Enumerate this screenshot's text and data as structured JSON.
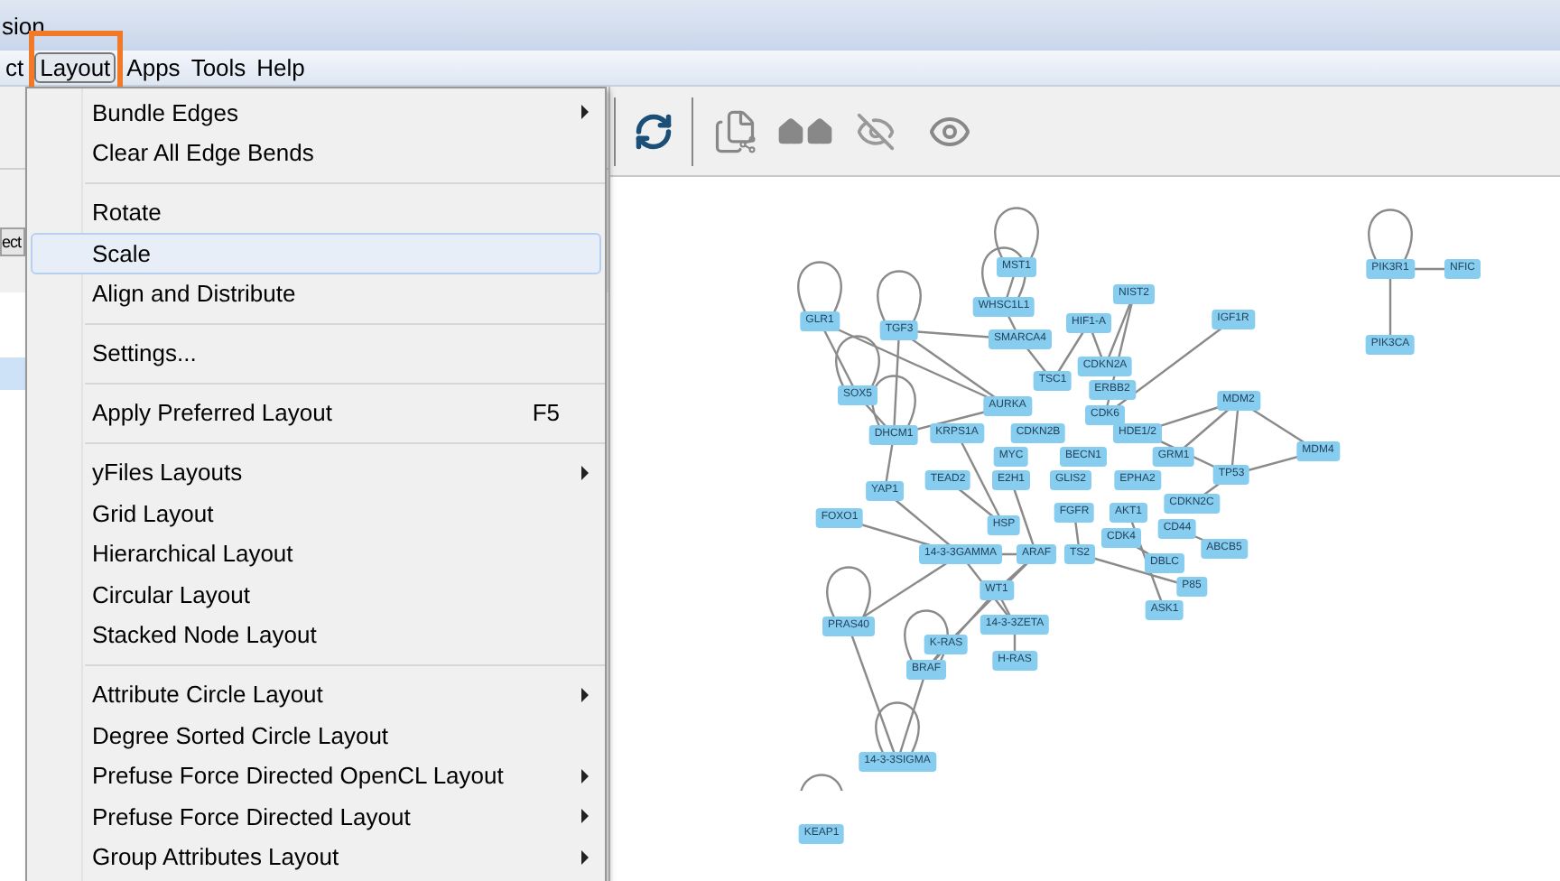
{
  "window": {
    "title": "sion"
  },
  "menu_bar": [
    {
      "label": "ct",
      "selected": false,
      "annotated": false
    },
    {
      "label": "Layout",
      "selected": true,
      "annotated": true
    },
    {
      "label": "Apps",
      "selected": false,
      "annotated": false
    },
    {
      "label": "Tools",
      "selected": false,
      "annotated": false
    },
    {
      "label": "Help",
      "selected": false,
      "annotated": false
    }
  ],
  "left_panel": {
    "button_label": "ect",
    "rows": [
      {
        "selected": true
      }
    ]
  },
  "layout_menu": [
    {
      "kind": "item",
      "label": "Bundle Edges",
      "submenu": true,
      "highlighted": false
    },
    {
      "kind": "item",
      "label": "Clear All Edge Bends",
      "submenu": false,
      "highlighted": false
    },
    {
      "kind": "separator"
    },
    {
      "kind": "item",
      "label": "Rotate",
      "submenu": false,
      "highlighted": false
    },
    {
      "kind": "item",
      "label": "Scale",
      "submenu": false,
      "highlighted": true
    },
    {
      "kind": "item",
      "label": "Align and Distribute",
      "submenu": false,
      "highlighted": false
    },
    {
      "kind": "separator"
    },
    {
      "kind": "item",
      "label": "Settings...",
      "submenu": false,
      "highlighted": false
    },
    {
      "kind": "separator"
    },
    {
      "kind": "item",
      "label": "Apply Preferred Layout",
      "shortcut": "F5",
      "submenu": false,
      "highlighted": false
    },
    {
      "kind": "separator"
    },
    {
      "kind": "item",
      "label": "yFiles Layouts",
      "submenu": true,
      "highlighted": false
    },
    {
      "kind": "item",
      "label": "Grid Layout",
      "submenu": false,
      "highlighted": false
    },
    {
      "kind": "item",
      "label": "Hierarchical Layout",
      "submenu": false,
      "highlighted": false
    },
    {
      "kind": "item",
      "label": "Circular Layout",
      "submenu": false,
      "highlighted": false
    },
    {
      "kind": "item",
      "label": "Stacked Node Layout",
      "submenu": false,
      "highlighted": false
    },
    {
      "kind": "separator"
    },
    {
      "kind": "item",
      "label": "Attribute Circle Layout",
      "submenu": true,
      "highlighted": false
    },
    {
      "kind": "item",
      "label": "Degree Sorted Circle Layout",
      "submenu": false,
      "highlighted": false
    },
    {
      "kind": "item",
      "label": "Prefuse Force Directed OpenCL Layout",
      "submenu": true,
      "highlighted": false
    },
    {
      "kind": "item",
      "label": "Prefuse Force Directed Layout",
      "submenu": true,
      "highlighted": false
    },
    {
      "kind": "item",
      "label": "Group Attributes Layout",
      "submenu": true,
      "highlighted": false
    }
  ],
  "network": {
    "nodes": [
      {
        "label": "MST1"
      },
      {
        "label": "WHSC1L1"
      },
      {
        "label": "NIST2"
      },
      {
        "label": "HIF1-A"
      },
      {
        "label": "SMARCA4"
      },
      {
        "label": "GLR1"
      },
      {
        "label": "TGF3"
      },
      {
        "label": "IGF1R"
      },
      {
        "label": "PIK3R1"
      },
      {
        "label": "NFIC"
      },
      {
        "label": "PIK3CA"
      },
      {
        "label": "SOX5"
      },
      {
        "label": "DHCM1"
      },
      {
        "label": "CDKN2A"
      },
      {
        "label": "ERBB2"
      },
      {
        "label": "TSC1"
      },
      {
        "label": "AURKA"
      },
      {
        "label": "MDM2"
      },
      {
        "label": "MDM4"
      },
      {
        "label": "TP53"
      },
      {
        "label": "CDKN2C"
      },
      {
        "label": "CD44"
      },
      {
        "label": "FGFR"
      },
      {
        "label": "AKT1"
      },
      {
        "label": "CDK4"
      },
      {
        "label": "HSP"
      },
      {
        "label": "ARAF"
      },
      {
        "label": "TS2"
      },
      {
        "label": "YAP1"
      },
      {
        "label": "FOXO1"
      },
      {
        "label": "TEAD2"
      },
      {
        "label": "E2H1"
      },
      {
        "label": "GLIS2"
      },
      {
        "label": "EPHA2"
      },
      {
        "label": "14-3-3GAMMA"
      },
      {
        "label": "WT1"
      },
      {
        "label": "PRAS40"
      },
      {
        "label": "K-RAS"
      },
      {
        "label": "14-3-3ZETA"
      },
      {
        "label": "H-RAS"
      },
      {
        "label": "BRAF"
      },
      {
        "label": "ABCB5"
      },
      {
        "label": "DBLC"
      },
      {
        "label": "P85"
      },
      {
        "label": "ASK1"
      },
      {
        "label": "14-3-3SIGMA"
      },
      {
        "label": "KEAP1"
      },
      {
        "label": "CDK6"
      },
      {
        "label": "HDE1/2"
      },
      {
        "label": "MYC"
      },
      {
        "label": "BECN1"
      },
      {
        "label": "GRM1"
      },
      {
        "label": "KRPS1A"
      },
      {
        "label": "CDKN2B"
      }
    ]
  }
}
